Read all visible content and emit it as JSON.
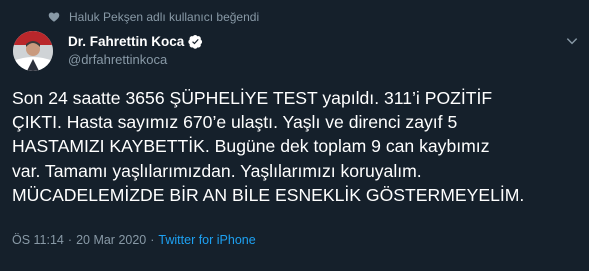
{
  "social_context": {
    "icon": "heart-icon",
    "text": "Haluk Pekşen adlı kullanıcı beğendi"
  },
  "author": {
    "display_name": "Dr. Fahrettin Koca",
    "handle": "@drfahrettinkoca",
    "verified": true
  },
  "tweet": {
    "lines": [
      "Son 24 saatte 3656 ŞÜPHELİYE TEST yapıldı. 311’i POZİTİF",
      "ÇIKTI. Hasta sayımız 670’e ulaştı. Yaşlı ve direnci zayıf 5",
      "HASTAMIZI KAYBETTİK. Bugüne dek toplam 9 can kaybımız",
      "var. Tamamı yaşlılarımızdan. Yaşlılarımızı koruyalım.",
      "MÜCADELEMİZDE BİR AN BİLE ESNEKLİK GÖSTERMEYELİM."
    ]
  },
  "meta": {
    "time": "ÖS 11:14",
    "separator": "·",
    "date": "20 Mar 2020",
    "source": "Twitter for iPhone"
  },
  "colors": {
    "background": "#15202b",
    "secondary_text": "#8899a6",
    "link": "#1da1f2",
    "verified_badge": "#ffffff"
  }
}
